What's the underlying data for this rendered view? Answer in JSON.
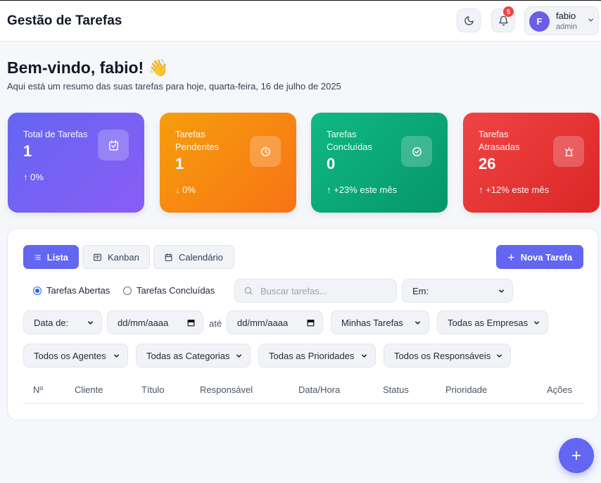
{
  "header": {
    "title": "Gestão de Tarefas",
    "notification_count": "5",
    "user": {
      "initial": "F",
      "name": "fabio",
      "role": "admin"
    }
  },
  "welcome": {
    "title": "Bem-vindo, fabio! 👋",
    "subtitle": "Aqui está um resumo das suas tarefas para hoje, quarta-feira, 16 de julho de 2025"
  },
  "stats": [
    {
      "label": "Total de Tarefas",
      "value": "1",
      "trend": "↑ 0%",
      "icon": "calendar-check-icon",
      "color": "#7062ef"
    },
    {
      "label": "Tarefas Pendentes",
      "value": "1",
      "trend": "↓ 0%",
      "icon": "clock-icon",
      "color": "#f59e0b"
    },
    {
      "label": "Tarefas Concluídas",
      "value": "0",
      "trend": "↑ +23% este mês",
      "icon": "check-circle-icon",
      "color": "#10b981"
    },
    {
      "label": "Tarefas Atrasadas",
      "value": "26",
      "trend": "↑ +12% este mês",
      "icon": "alarm-icon",
      "color": "#ef4444"
    }
  ],
  "views": {
    "list": "Lista",
    "kanban": "Kanban",
    "calendar": "Calendário",
    "active": "Lista"
  },
  "new_task_label": "Nova Tarefa",
  "filters": {
    "status_open": "Tarefas Abertas",
    "status_done": "Tarefas Concluídas",
    "status_selected": "Tarefas Abertas",
    "search_placeholder": "Buscar tarefas...",
    "in_select": "Em:",
    "date_type": "Data de:",
    "date_from": "dd/mm/aaaa",
    "date_sep": "até",
    "date_to": "dd/mm/aaaa",
    "scope": "Minhas Tarefas",
    "companies": "Todas as Empresas",
    "agents": "Todos os Agentes",
    "categories": "Todas as Categorias",
    "priorities": "Todas as Prioridades",
    "owners": "Todos os Responsáveis"
  },
  "table": {
    "columns": [
      "Nº",
      "Cliente",
      "Título",
      "Responsável",
      "Data/Hora",
      "Status",
      "Prioridade",
      "Ações"
    ]
  }
}
